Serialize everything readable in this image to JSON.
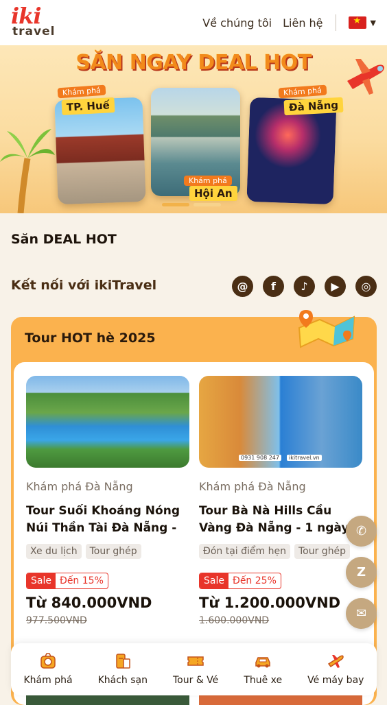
{
  "header": {
    "logo_top": "iki",
    "logo_bottom": "travel",
    "nav": [
      "Về chúng tôi",
      "Liên hệ"
    ],
    "language_flag": "vn-flag-icon"
  },
  "banner": {
    "title": "SĂN NGAY DEAL HOT",
    "cards": [
      {
        "tag": "Khám phá",
        "name": "TP. Huế"
      },
      {
        "tag": "Khám phá",
        "name": "Hội An"
      },
      {
        "tag": "Khám phá",
        "name": "Đà Nẵng"
      }
    ],
    "slides_total": 2,
    "active_slide": 1
  },
  "deal_section": {
    "title": "Săn DEAL HOT"
  },
  "connect": {
    "title": "Kết nối với ikiTravel",
    "socials": [
      "threads-icon",
      "facebook-icon",
      "tiktok-icon",
      "youtube-icon",
      "instagram-icon"
    ]
  },
  "hot_tours": {
    "title": "Tour HOT hè 2025",
    "tours": [
      {
        "location": "Khám phá Đà Nẵng",
        "name": "Tour Suối Khoáng Nóng Núi Thần Tài Đà Nẵng - ...",
        "chips": [
          "Xe du lịch",
          "Tour ghép"
        ],
        "sale_label": "Sale",
        "discount": "Đến 15%",
        "price": "Từ 840.000VND",
        "old_price": "977.500VND"
      },
      {
        "location": "Khám phá Đà Nẵng",
        "name": "Tour Bà Nà Hills Cầu Vàng Đà Nẵng - 1 ngày",
        "chips": [
          "Đón tại điểm hẹn",
          "Tour ghép"
        ],
        "sale_label": "Sale",
        "discount": "Đến 25%",
        "price": "Từ 1.200.000VND",
        "old_price": "1.600.000VND",
        "image_caption_phone": "0931 908 247",
        "image_caption_site": "ikitravel.vn"
      }
    ]
  },
  "floating": [
    "phone-icon",
    "zalo-icon",
    "messenger-icon"
  ],
  "bottom_nav": [
    {
      "label": "Khám phá",
      "icon": "explore-icon"
    },
    {
      "label": "Khách sạn",
      "icon": "hotel-icon"
    },
    {
      "label": "Tour & Vé",
      "icon": "ticket-icon"
    },
    {
      "label": "Thuê xe",
      "icon": "car-icon"
    },
    {
      "label": "Vé máy bay",
      "icon": "plane-icon"
    }
  ],
  "colors": {
    "brand_red": "#e8352a",
    "brand_orange": "#fbb24e",
    "brown": "#4a2e14"
  }
}
